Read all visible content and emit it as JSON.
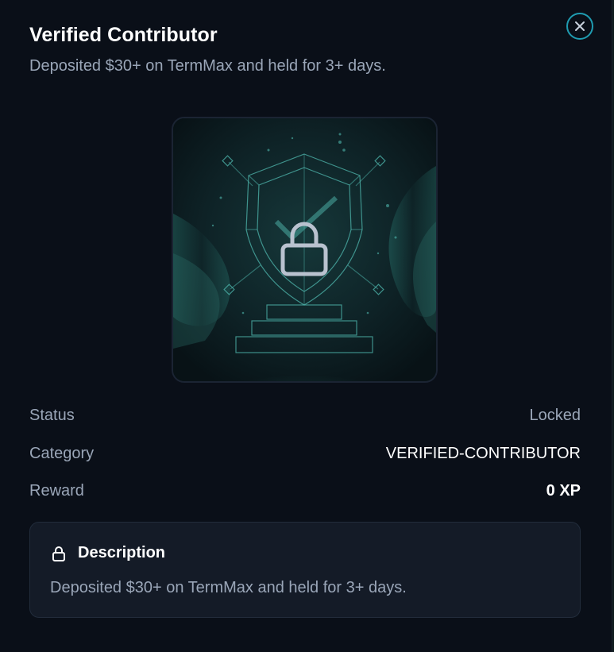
{
  "modal": {
    "title": "Verified Contributor",
    "subtitle": "Deposited $30+ on TermMax and held for 3+ days."
  },
  "badge_image": {
    "icon": "shield-lock-icon",
    "state": "locked"
  },
  "details": [
    {
      "label": "Status",
      "value": "Locked"
    },
    {
      "label": "Category",
      "value": "VERIFIED-CONTRIBUTOR"
    },
    {
      "label": "Reward",
      "value": "0 XP"
    }
  ],
  "description": {
    "heading": "Description",
    "text": "Deposited $30+ on TermMax and held for 3+ days."
  },
  "colors": {
    "accent": "#1f9bb0",
    "background": "#0a0f18",
    "muted_text": "#9aa6b8",
    "card": "#141b27"
  }
}
